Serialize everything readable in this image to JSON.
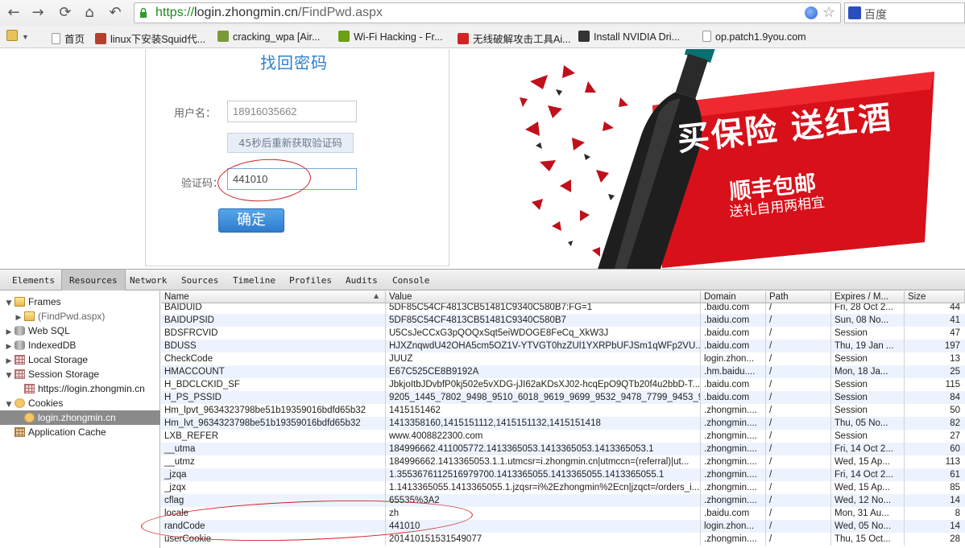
{
  "browser": {
    "url_scheme": "https://",
    "url_host": "login.zhongmin.cn",
    "url_path": "/FindPwd.aspx",
    "search_placeholder": "百度",
    "nav_back": "←",
    "nav_forward": "→",
    "nav_reload": "⟳",
    "nav_home": "⌂",
    "nav_undo": "↶",
    "star": "☆",
    "bookmarks": [
      {
        "label": "首页",
        "icon": "page-icon"
      },
      {
        "label": "linux下安装Squid代...",
        "icon": "site-icon",
        "color": "#b5402a"
      },
      {
        "label": "cracking_wpa [Air...",
        "icon": "site-icon",
        "color": "#7a9a3a"
      },
      {
        "label": "Wi-Fi Hacking - Fr...",
        "icon": "site-icon",
        "color": "#6aa012"
      },
      {
        "label": "无线破解攻击工具Ai...",
        "icon": "site-icon",
        "color": "#d22222"
      },
      {
        "label": "Install NVIDIA Dri...",
        "icon": "site-icon",
        "color": "#333333"
      },
      {
        "label": "op.patch1.9you.com",
        "icon": "page-icon"
      }
    ]
  },
  "form": {
    "title": "找回密码",
    "username_label": "用户名：",
    "username_value": "18916035662",
    "resend_label": "45秒后重新获取验证码",
    "code_label": "验证码：",
    "code_value": "441010",
    "confirm_label": "确定"
  },
  "ad": {
    "headline": "买保险 送红酒",
    "sub1": "顺丰包邮",
    "sub2": "送礼自用两相宜",
    "accent": "#d8101a"
  },
  "devtools": {
    "tabs": [
      "Elements",
      "Resources",
      "Network",
      "Sources",
      "Timeline",
      "Profiles",
      "Audits",
      "Console"
    ],
    "active_tab": "Resources",
    "tree": [
      {
        "label": "Frames",
        "icon": "folder-icon",
        "arrow": "▼",
        "indent": 0
      },
      {
        "label": "(FindPwd.aspx)",
        "icon": "folder-icon",
        "arrow": "▶",
        "indent": 1,
        "muted": true
      },
      {
        "label": "Web SQL",
        "icon": "db-icon",
        "arrow": "▶",
        "indent": 0
      },
      {
        "label": "IndexedDB",
        "icon": "db-icon",
        "arrow": "▶",
        "indent": 0
      },
      {
        "label": "Local Storage",
        "icon": "grid-icon",
        "arrow": "▶",
        "indent": 0
      },
      {
        "label": "Session Storage",
        "icon": "grid-icon",
        "arrow": "▼",
        "indent": 0
      },
      {
        "label": "https://login.zhongmin.cn",
        "icon": "grid-icon",
        "arrow": "",
        "indent": 1
      },
      {
        "label": "Cookies",
        "icon": "cookie-icon",
        "arrow": "▼",
        "indent": 0
      },
      {
        "label": "login.zhongmin.cn",
        "icon": "cookie-icon",
        "arrow": "",
        "indent": 1,
        "selected": true
      },
      {
        "label": "Application Cache",
        "icon": "appcache-icon",
        "arrow": "",
        "indent": 0
      }
    ],
    "columns": [
      "Name",
      "Value",
      "Domain",
      "Path",
      "Expires / M...",
      "Size"
    ],
    "rows": [
      [
        "BAIDUID",
        "5DF85C54CF4813CB51481C9340C580B7:FG=1",
        ".baidu.com",
        "/",
        "Fri, 28 Oct 2...",
        "44"
      ],
      [
        "BAIDUPSID",
        "5DF85C54CF4813CB51481C9340C580B7",
        ".baidu.com",
        "/",
        "Sun, 08 No...",
        "41"
      ],
      [
        "BDSFRCVID",
        "U5CsJeCCxG3pQOQxSqt5eiWDOGE8FeCq_XkW3J",
        ".baidu.com",
        "/",
        "Session",
        "47"
      ],
      [
        "BDUSS",
        "HJXZnqwdU42OHA5cm5OZ1V-YTVGT0hzZUl1YXRPbUFJSm1qWFp2VU...",
        ".baidu.com",
        "/",
        "Thu, 19 Jan ...",
        "197"
      ],
      [
        "CheckCode",
        "JUUZ",
        "login.zhon...",
        "/",
        "Session",
        "13"
      ],
      [
        "HMACCOUNT",
        "E67C525CE8B9192A",
        ".hm.baidu....",
        "/",
        "Mon, 18 Ja...",
        "25"
      ],
      [
        "H_BDCLCKID_SF",
        "JbkjoItbJDvbfP0kj502e5vXDG-jJI62aKDsXJ02-hcqEpO9QTb20f4u2bbD-T...",
        ".baidu.com",
        "/",
        "Session",
        "115"
      ],
      [
        "H_PS_PSSID",
        "9205_1445_7802_9498_9510_6018_9619_9699_9532_9478_7799_9453_9192...",
        ".baidu.com",
        "/",
        "Session",
        "84"
      ],
      [
        "Hm_lpvt_9634323798be51b19359016bdfd65b32",
        "1415151462",
        ".zhongmin....",
        "/",
        "Session",
        "50"
      ],
      [
        "Hm_lvt_9634323798be51b19359016bdfd65b32",
        "1413358160,1415151112,1415151132,1415151418",
        ".zhongmin....",
        "/",
        "Thu, 05 No...",
        "82"
      ],
      [
        "LXB_REFER",
        "www.4008822300.com",
        ".zhongmin....",
        "/",
        "Session",
        "27"
      ],
      [
        "__utma",
        "184996662.411005772.1413365053.1413365053.1413365053.1",
        ".zhongmin....",
        "/",
        "Fri, 14 Oct 2...",
        "60"
      ],
      [
        "__utmz",
        "184996662.1413365053.1.1.utmcsr=i.zhongmin.cn|utmccn=(referral)|ut...",
        ".zhongmin....",
        "/",
        "Wed, 15 Ap...",
        "113"
      ],
      [
        "_jzqa",
        "1.3553676112516979700.1413365055.1413365055.1413365055.1",
        ".zhongmin....",
        "/",
        "Fri, 14 Oct 2...",
        "61"
      ],
      [
        "_jzqx",
        "1.1413365055.1413365055.1.jzqsr=i%2Ezhongmin%2Ecn|jzqct=/orders_i...",
        ".zhongmin....",
        "/",
        "Wed, 15 Ap...",
        "85"
      ],
      [
        "cflag",
        "65535%3A2",
        ".zhongmin....",
        "/",
        "Wed, 12 No...",
        "14"
      ],
      [
        "locale",
        "zh",
        ".baidu.com",
        "/",
        "Mon, 31 Au...",
        "8"
      ],
      [
        "randCode",
        "441010",
        "login.zhon...",
        "/",
        "Wed, 05 No...",
        "14"
      ],
      [
        "userCookie",
        "201410151531549077",
        ".zhongmin....",
        "/",
        "Thu, 15 Oct...",
        "28"
      ]
    ]
  }
}
